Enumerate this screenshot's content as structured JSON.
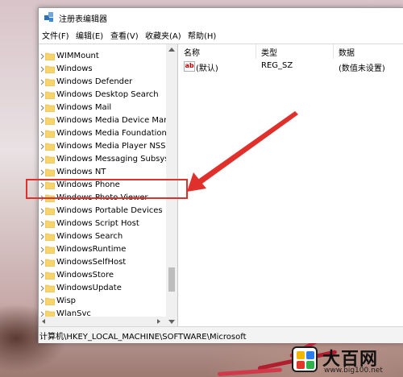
{
  "window": {
    "title": "注册表编辑器"
  },
  "menu": [
    "文件(F)",
    "编辑(E)",
    "查看(V)",
    "收藏夹(A)",
    "帮助(H)"
  ],
  "tree": {
    "items": [
      "WIMMount",
      "Windows",
      "Windows Defender",
      "Windows Desktop Search",
      "Windows Mail",
      "Windows Media Device Mana",
      "Windows Media Foundation",
      "Windows Media Player NSS",
      "Windows Messaging Subsyst",
      "Windows NT",
      "Windows Phone",
      "Windows Photo Viewer",
      "Windows Portable Devices",
      "Windows Script Host",
      "Windows Search",
      "WindowsRuntime",
      "WindowsSelfHost",
      "WindowsStore",
      "WindowsUpdate",
      "Wisp",
      "WlanSvc"
    ],
    "highlighted": "Windows Photo Viewer"
  },
  "list": {
    "columns": {
      "name": "名称",
      "type": "类型",
      "data": "数据"
    },
    "rows": [
      {
        "icon": "string-value-icon",
        "icon_text": "ab",
        "name": "(默认)",
        "type": "REG_SZ",
        "data": "(数值未设置)"
      }
    ]
  },
  "status": {
    "path": "计算机\\HKEY_LOCAL_MACHINE\\SOFTWARE\\Microsoft"
  },
  "watermark": {
    "title": "大百网",
    "url": "www.big100.net"
  },
  "colors": {
    "annotation": "#e0302c",
    "folder": "#f6d46b",
    "window_bg": "#ffffff"
  }
}
